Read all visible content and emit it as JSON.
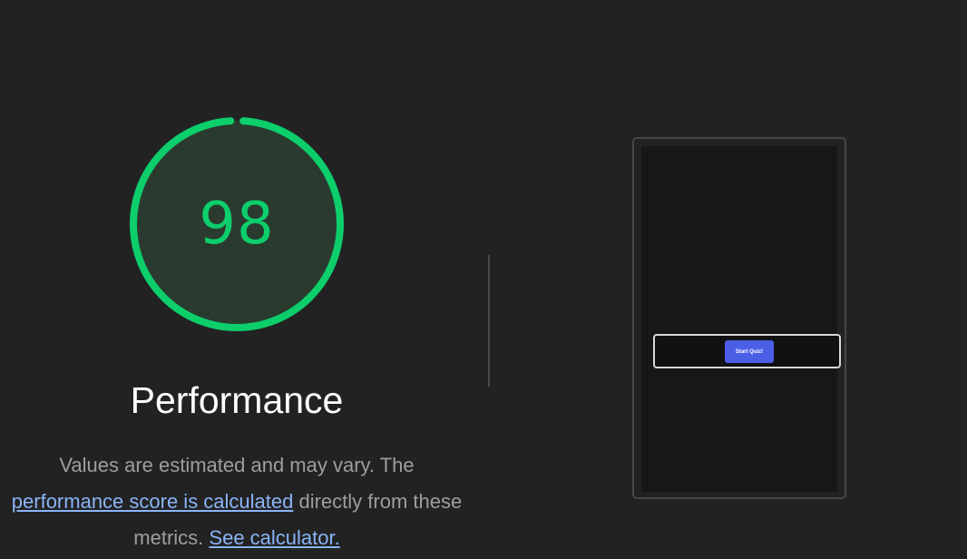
{
  "score": {
    "value": "98",
    "fraction": 0.98,
    "color": "#0cce6b",
    "track_color": "#2a3a2e"
  },
  "category": {
    "title": "Performance"
  },
  "description": {
    "text1": "Values are estimated and may vary. The ",
    "link1": "performance score is calculated",
    "text2": " directly from these metrics. ",
    "link2": "See calculator."
  },
  "screenshot": {
    "button_label": "Start Quiz!",
    "button_color": "#4a5fe6"
  },
  "colors": {
    "background": "#222222",
    "link": "#8ab4f8",
    "muted_text": "#9e9e9e"
  }
}
